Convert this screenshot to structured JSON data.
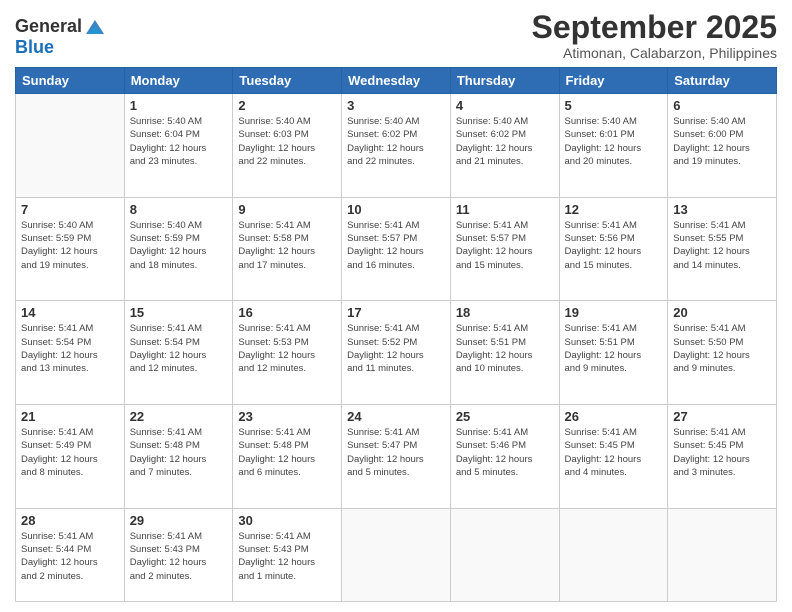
{
  "logo": {
    "general": "General",
    "blue": "Blue"
  },
  "title": "September 2025",
  "location": "Atimonan, Calabarzon, Philippines",
  "days_of_week": [
    "Sunday",
    "Monday",
    "Tuesday",
    "Wednesday",
    "Thursday",
    "Friday",
    "Saturday"
  ],
  "weeks": [
    [
      {
        "day": "",
        "info": ""
      },
      {
        "day": "1",
        "info": "Sunrise: 5:40 AM\nSunset: 6:04 PM\nDaylight: 12 hours\nand 23 minutes."
      },
      {
        "day": "2",
        "info": "Sunrise: 5:40 AM\nSunset: 6:03 PM\nDaylight: 12 hours\nand 22 minutes."
      },
      {
        "day": "3",
        "info": "Sunrise: 5:40 AM\nSunset: 6:02 PM\nDaylight: 12 hours\nand 22 minutes."
      },
      {
        "day": "4",
        "info": "Sunrise: 5:40 AM\nSunset: 6:02 PM\nDaylight: 12 hours\nand 21 minutes."
      },
      {
        "day": "5",
        "info": "Sunrise: 5:40 AM\nSunset: 6:01 PM\nDaylight: 12 hours\nand 20 minutes."
      },
      {
        "day": "6",
        "info": "Sunrise: 5:40 AM\nSunset: 6:00 PM\nDaylight: 12 hours\nand 19 minutes."
      }
    ],
    [
      {
        "day": "7",
        "info": "Sunrise: 5:40 AM\nSunset: 5:59 PM\nDaylight: 12 hours\nand 19 minutes."
      },
      {
        "day": "8",
        "info": "Sunrise: 5:40 AM\nSunset: 5:59 PM\nDaylight: 12 hours\nand 18 minutes."
      },
      {
        "day": "9",
        "info": "Sunrise: 5:41 AM\nSunset: 5:58 PM\nDaylight: 12 hours\nand 17 minutes."
      },
      {
        "day": "10",
        "info": "Sunrise: 5:41 AM\nSunset: 5:57 PM\nDaylight: 12 hours\nand 16 minutes."
      },
      {
        "day": "11",
        "info": "Sunrise: 5:41 AM\nSunset: 5:57 PM\nDaylight: 12 hours\nand 15 minutes."
      },
      {
        "day": "12",
        "info": "Sunrise: 5:41 AM\nSunset: 5:56 PM\nDaylight: 12 hours\nand 15 minutes."
      },
      {
        "day": "13",
        "info": "Sunrise: 5:41 AM\nSunset: 5:55 PM\nDaylight: 12 hours\nand 14 minutes."
      }
    ],
    [
      {
        "day": "14",
        "info": "Sunrise: 5:41 AM\nSunset: 5:54 PM\nDaylight: 12 hours\nand 13 minutes."
      },
      {
        "day": "15",
        "info": "Sunrise: 5:41 AM\nSunset: 5:54 PM\nDaylight: 12 hours\nand 12 minutes."
      },
      {
        "day": "16",
        "info": "Sunrise: 5:41 AM\nSunset: 5:53 PM\nDaylight: 12 hours\nand 12 minutes."
      },
      {
        "day": "17",
        "info": "Sunrise: 5:41 AM\nSunset: 5:52 PM\nDaylight: 12 hours\nand 11 minutes."
      },
      {
        "day": "18",
        "info": "Sunrise: 5:41 AM\nSunset: 5:51 PM\nDaylight: 12 hours\nand 10 minutes."
      },
      {
        "day": "19",
        "info": "Sunrise: 5:41 AM\nSunset: 5:51 PM\nDaylight: 12 hours\nand 9 minutes."
      },
      {
        "day": "20",
        "info": "Sunrise: 5:41 AM\nSunset: 5:50 PM\nDaylight: 12 hours\nand 9 minutes."
      }
    ],
    [
      {
        "day": "21",
        "info": "Sunrise: 5:41 AM\nSunset: 5:49 PM\nDaylight: 12 hours\nand 8 minutes."
      },
      {
        "day": "22",
        "info": "Sunrise: 5:41 AM\nSunset: 5:48 PM\nDaylight: 12 hours\nand 7 minutes."
      },
      {
        "day": "23",
        "info": "Sunrise: 5:41 AM\nSunset: 5:48 PM\nDaylight: 12 hours\nand 6 minutes."
      },
      {
        "day": "24",
        "info": "Sunrise: 5:41 AM\nSunset: 5:47 PM\nDaylight: 12 hours\nand 5 minutes."
      },
      {
        "day": "25",
        "info": "Sunrise: 5:41 AM\nSunset: 5:46 PM\nDaylight: 12 hours\nand 5 minutes."
      },
      {
        "day": "26",
        "info": "Sunrise: 5:41 AM\nSunset: 5:45 PM\nDaylight: 12 hours\nand 4 minutes."
      },
      {
        "day": "27",
        "info": "Sunrise: 5:41 AM\nSunset: 5:45 PM\nDaylight: 12 hours\nand 3 minutes."
      }
    ],
    [
      {
        "day": "28",
        "info": "Sunrise: 5:41 AM\nSunset: 5:44 PM\nDaylight: 12 hours\nand 2 minutes."
      },
      {
        "day": "29",
        "info": "Sunrise: 5:41 AM\nSunset: 5:43 PM\nDaylight: 12 hours\nand 2 minutes."
      },
      {
        "day": "30",
        "info": "Sunrise: 5:41 AM\nSunset: 5:43 PM\nDaylight: 12 hours\nand 1 minute."
      },
      {
        "day": "",
        "info": ""
      },
      {
        "day": "",
        "info": ""
      },
      {
        "day": "",
        "info": ""
      },
      {
        "day": "",
        "info": ""
      }
    ]
  ]
}
